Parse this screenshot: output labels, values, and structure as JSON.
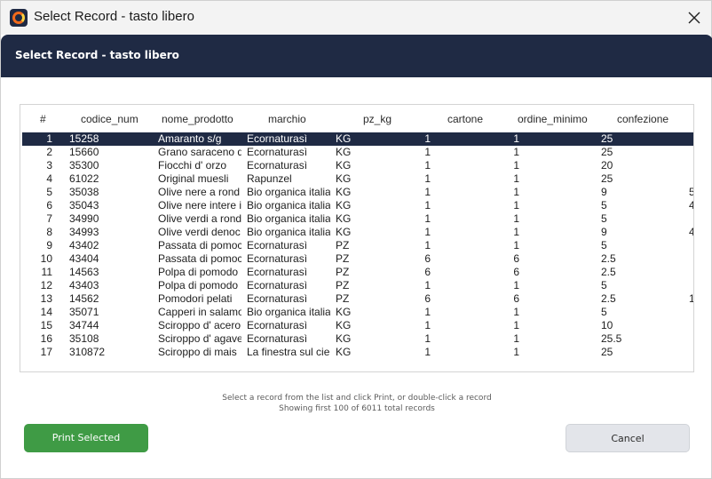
{
  "window": {
    "title": "Select Record - tasto libero"
  },
  "header": {
    "title": "Select Record - tasto libero"
  },
  "table": {
    "columns": [
      "#",
      "codice_num",
      "nome_prodotto",
      "marchio",
      "pz_kg",
      "cartone",
      "ordine_minimo",
      "confezione"
    ],
    "rows": [
      [
        "1",
        "15258",
        "Amaranto s/g",
        "Ecornaturasì",
        "KG",
        "1",
        "1",
        "25",
        ""
      ],
      [
        "2",
        "15660",
        "Grano saraceno d",
        "Ecornaturasì",
        "KG",
        "1",
        "1",
        "25",
        ""
      ],
      [
        "3",
        "35300",
        "Fiocchi d' orzo",
        "Ecornaturasì",
        "KG",
        "1",
        "1",
        "20",
        ""
      ],
      [
        "4",
        "61022",
        "Original muesli",
        "Rapunzel",
        "KG",
        "1",
        "1",
        "25",
        ""
      ],
      [
        "5",
        "35038",
        "Olive nere a rond",
        "Bio organica italia",
        "KG",
        "1",
        "1",
        "9",
        "5"
      ],
      [
        "6",
        "35043",
        "Olive nere intere i",
        "Bio organica italia",
        "KG",
        "1",
        "1",
        "5",
        "4"
      ],
      [
        "7",
        "34990",
        "Olive verdi a rond",
        "Bio organica italia",
        "KG",
        "1",
        "1",
        "5",
        ""
      ],
      [
        "8",
        "34993",
        "Olive verdi denoc",
        "Bio organica italia",
        "KG",
        "1",
        "1",
        "9",
        "4"
      ],
      [
        "9",
        "43402",
        "Passata di pomoc",
        "Ecornaturasì",
        "PZ",
        "1",
        "1",
        "5",
        ""
      ],
      [
        "10",
        "43404",
        "Passata di pomoc",
        "Ecornaturasì",
        "PZ",
        "6",
        "6",
        "2.5",
        ""
      ],
      [
        "11",
        "14563",
        "Polpa di pomodo",
        "Ecornaturasì",
        "PZ",
        "6",
        "6",
        "2.5",
        ""
      ],
      [
        "12",
        "43403",
        "Polpa di pomodo",
        "Ecornaturasì",
        "PZ",
        "1",
        "1",
        "5",
        ""
      ],
      [
        "13",
        "14562",
        "Pomodori pelati",
        "Ecornaturasì",
        "PZ",
        "6",
        "6",
        "2.5",
        "1"
      ],
      [
        "14",
        "35071",
        "Capperi in salamo",
        "Bio organica italia",
        "KG",
        "1",
        "1",
        "5",
        ""
      ],
      [
        "15",
        "34744",
        "Sciroppo d' acero",
        "Ecornaturasì",
        "KG",
        "1",
        "1",
        "10",
        ""
      ],
      [
        "16",
        "35108",
        "Sciroppo d' agave",
        "Ecornaturasì",
        "KG",
        "1",
        "1",
        "25.5",
        ""
      ],
      [
        "17",
        "310872",
        "Sciroppo di mais",
        "La finestra sul ciel",
        "KG",
        "1",
        "1",
        "25",
        ""
      ]
    ],
    "selected_row": 0
  },
  "info": {
    "line1": "Select a record from the list and click Print, or double-click a record",
    "line2": "Showing first 100 of 6011 total records"
  },
  "buttons": {
    "print": "Print Selected",
    "cancel": "Cancel"
  },
  "colors": {
    "header_bg": "#1f2a44",
    "print_button": "#3f9b45",
    "cancel_button": "#e3e5ea"
  },
  "icons": {
    "app": "app-logo-icon",
    "close": "close-icon"
  }
}
